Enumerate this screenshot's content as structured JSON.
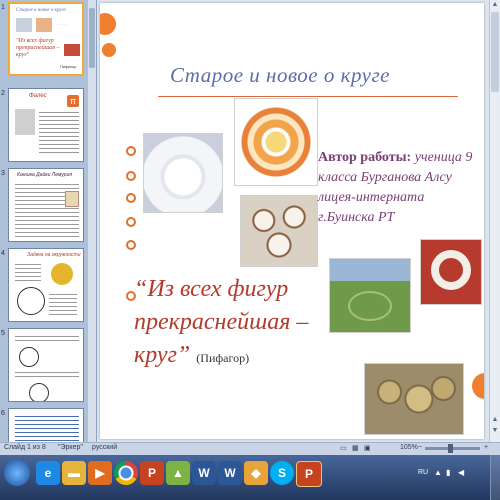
{
  "colors": {
    "title": "#5a6fa8",
    "accent_orange": "#f08030",
    "author": "#7a3e74",
    "quote": "#b33a2c"
  },
  "thumbnails": [
    {
      "number": "1",
      "title": "Старое и новое о круге",
      "quote": "\"Из всех фигур прекраснейшая – круг\"",
      "attribution": "Пифагор"
    },
    {
      "number": "2",
      "title": "Фалес"
    },
    {
      "number": "3",
      "title": "Каншка Дайки Лемурия"
    },
    {
      "number": "4",
      "title": "Задача на окружности"
    },
    {
      "number": "5"
    },
    {
      "number": "6"
    }
  ],
  "slide": {
    "title": "Старое и новое о круге",
    "author_label": "Автор работы:",
    "author_text": "ученица 9 класса Бурганова Алсу лицея-интерната г.Буинска РТ",
    "quote": "“Из всех фигур прекраснейшая – круг”",
    "quote_attribution": "(Пифагор)"
  },
  "status_bar": {
    "slide_info": "Слайд 1 из 8",
    "theme": "\"Эркер\"",
    "language": "русский",
    "zoom": "105%"
  },
  "taskbar": {
    "apps": [
      {
        "label": "",
        "icon": "start-orb-icon"
      },
      {
        "label": "",
        "icon": "ie-icon"
      },
      {
        "label": "",
        "icon": "folder-icon"
      },
      {
        "label": "",
        "icon": "media-player-icon"
      },
      {
        "label": "",
        "icon": "chrome-icon"
      },
      {
        "label": "P",
        "icon": "powerpoint-icon"
      },
      {
        "label": "",
        "icon": "photo-icon"
      },
      {
        "label": "W",
        "icon": "word-icon"
      },
      {
        "label": "W",
        "icon": "word-icon-2"
      },
      {
        "label": "",
        "icon": "app-icon"
      },
      {
        "label": "S",
        "icon": "skype-icon"
      },
      {
        "label": "P",
        "icon": "powerpoint-icon-2"
      }
    ],
    "lang_indicator": "RU"
  }
}
